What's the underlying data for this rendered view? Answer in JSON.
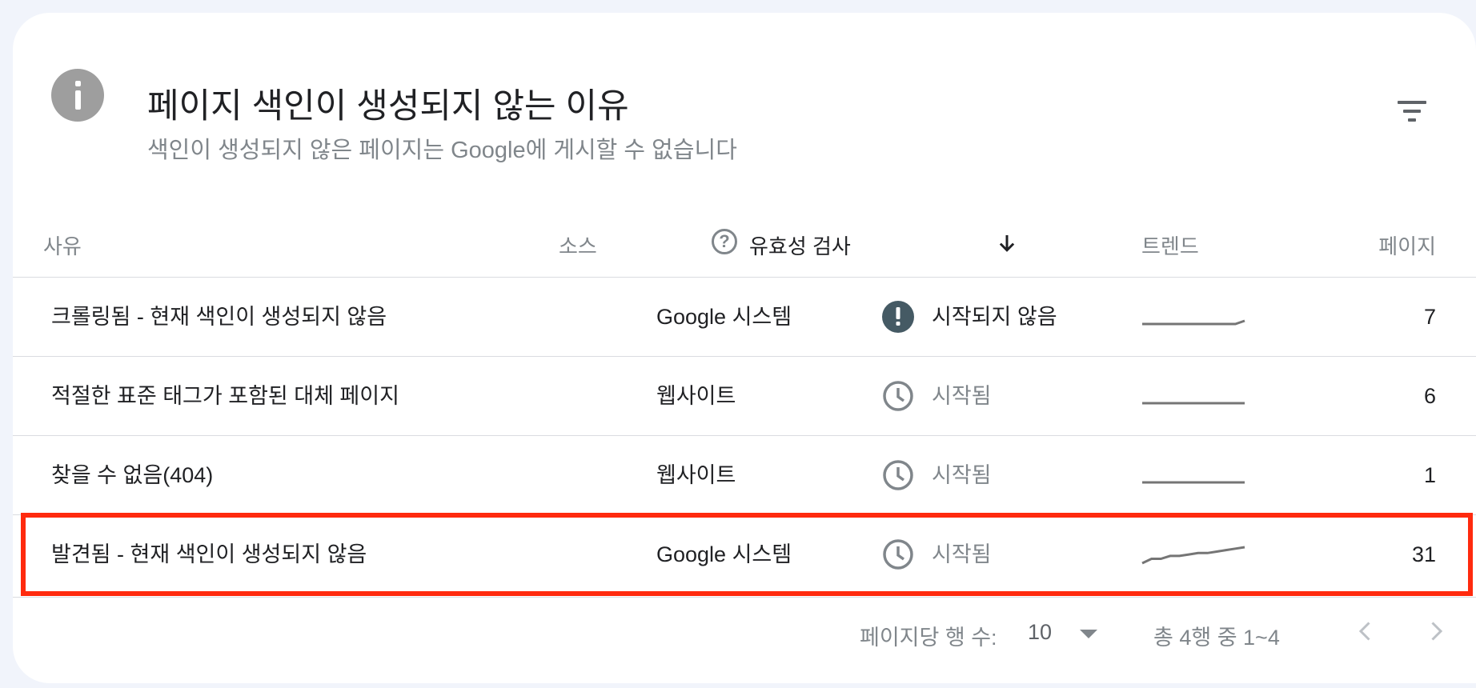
{
  "header": {
    "title": "페이지 색인이 생성되지 않는 이유",
    "subtitle": "색인이 생성되지 않은 페이지는 Google에 게시할 수 없습니다"
  },
  "columns": {
    "reason": "사유",
    "source": "소스",
    "validation": "유효성 검사",
    "trend": "트렌드",
    "pages": "페이지"
  },
  "rows": [
    {
      "reason": "크롤링됨 - 현재 색인이 생성되지 않음",
      "source": "Google 시스템",
      "status": "시작되지 않음",
      "status_icon": "alert-icon",
      "pages": "7",
      "trend": [
        1,
        1,
        1,
        1,
        1,
        1,
        1,
        1,
        1,
        1,
        1,
        1.4
      ]
    },
    {
      "reason": "적절한 표준 태그가 포함된 대체 페이지",
      "source": "웹사이트",
      "status": "시작됨",
      "status_icon": "clock-icon",
      "pages": "6",
      "trend": [
        1,
        1,
        1,
        1,
        1,
        1,
        1,
        1,
        1,
        1,
        1,
        1
      ]
    },
    {
      "reason": "찾을 수 없음(404)",
      "source": "웹사이트",
      "status": "시작됨",
      "status_icon": "clock-icon",
      "pages": "1",
      "trend": [
        1,
        1,
        1,
        1,
        1,
        1,
        1,
        1,
        1,
        1,
        1,
        1
      ]
    },
    {
      "reason": "발견됨 - 현재 색인이 생성되지 않음",
      "source": "Google 시스템",
      "status": "시작됨",
      "status_icon": "clock-icon",
      "pages": "31",
      "trend": [
        20,
        23,
        23,
        25,
        25,
        26,
        27,
        27,
        28,
        29,
        30,
        31
      ]
    }
  ],
  "pagination": {
    "rows_per_page_label": "페이지당 행 수:",
    "rows_per_page": "10",
    "range": "총 4행 중 1~4"
  },
  "colors": {
    "highlight": "#ff2a0e",
    "alert": "#455a64",
    "muted": "#80868b"
  }
}
